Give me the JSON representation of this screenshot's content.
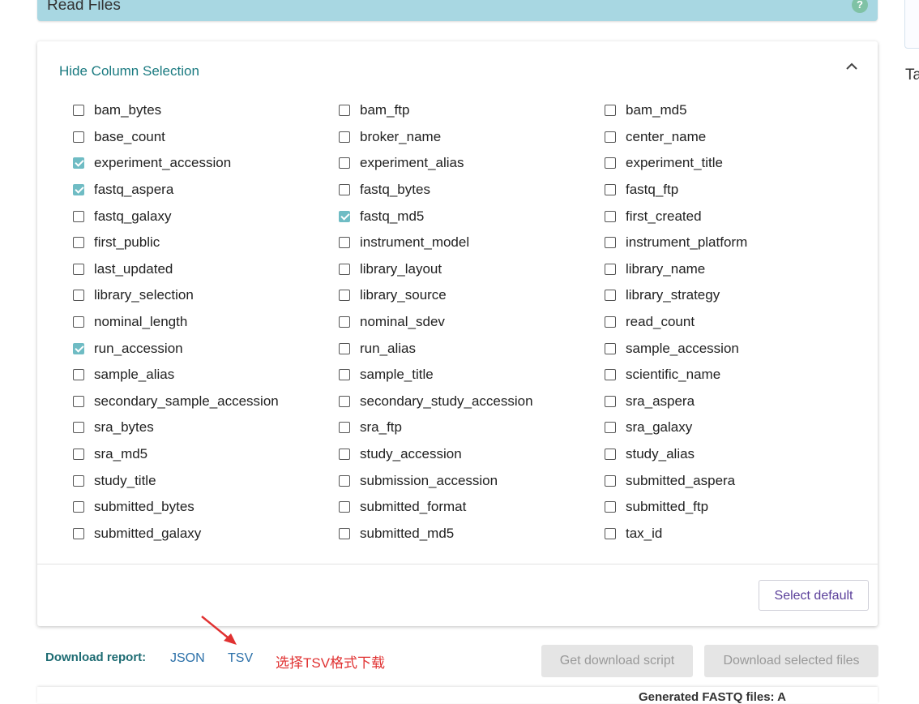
{
  "header": {
    "title": "Read Files",
    "help_symbol": "?"
  },
  "side": {
    "text": "Ta"
  },
  "column_selection": {
    "toggle_label": "Hide Column Selection",
    "columns": [
      {
        "label": "bam_bytes",
        "checked": false
      },
      {
        "label": "bam_ftp",
        "checked": false
      },
      {
        "label": "bam_md5",
        "checked": false
      },
      {
        "label": "base_count",
        "checked": false
      },
      {
        "label": "broker_name",
        "checked": false
      },
      {
        "label": "center_name",
        "checked": false
      },
      {
        "label": "experiment_accession",
        "checked": true
      },
      {
        "label": "experiment_alias",
        "checked": false
      },
      {
        "label": "experiment_title",
        "checked": false
      },
      {
        "label": "fastq_aspera",
        "checked": true
      },
      {
        "label": "fastq_bytes",
        "checked": false
      },
      {
        "label": "fastq_ftp",
        "checked": false
      },
      {
        "label": "fastq_galaxy",
        "checked": false
      },
      {
        "label": "fastq_md5",
        "checked": true
      },
      {
        "label": "first_created",
        "checked": false
      },
      {
        "label": "first_public",
        "checked": false
      },
      {
        "label": "instrument_model",
        "checked": false
      },
      {
        "label": "instrument_platform",
        "checked": false
      },
      {
        "label": "last_updated",
        "checked": false
      },
      {
        "label": "library_layout",
        "checked": false
      },
      {
        "label": "library_name",
        "checked": false
      },
      {
        "label": "library_selection",
        "checked": false
      },
      {
        "label": "library_source",
        "checked": false
      },
      {
        "label": "library_strategy",
        "checked": false
      },
      {
        "label": "nominal_length",
        "checked": false
      },
      {
        "label": "nominal_sdev",
        "checked": false
      },
      {
        "label": "read_count",
        "checked": false
      },
      {
        "label": "run_accession",
        "checked": true
      },
      {
        "label": "run_alias",
        "checked": false
      },
      {
        "label": "sample_accession",
        "checked": false
      },
      {
        "label": "sample_alias",
        "checked": false
      },
      {
        "label": "sample_title",
        "checked": false
      },
      {
        "label": "scientific_name",
        "checked": false
      },
      {
        "label": "secondary_sample_accession",
        "checked": false
      },
      {
        "label": "secondary_study_accession",
        "checked": false
      },
      {
        "label": "sra_aspera",
        "checked": false
      },
      {
        "label": "sra_bytes",
        "checked": false
      },
      {
        "label": "sra_ftp",
        "checked": false
      },
      {
        "label": "sra_galaxy",
        "checked": false
      },
      {
        "label": "sra_md5",
        "checked": false
      },
      {
        "label": "study_accession",
        "checked": false
      },
      {
        "label": "study_alias",
        "checked": false
      },
      {
        "label": "study_title",
        "checked": false
      },
      {
        "label": "submission_accession",
        "checked": false
      },
      {
        "label": "submitted_aspera",
        "checked": false
      },
      {
        "label": "submitted_bytes",
        "checked": false
      },
      {
        "label": "submitted_format",
        "checked": false
      },
      {
        "label": "submitted_ftp",
        "checked": false
      },
      {
        "label": "submitted_galaxy",
        "checked": false
      },
      {
        "label": "submitted_md5",
        "checked": false
      },
      {
        "label": "tax_id",
        "checked": false
      }
    ],
    "select_default_label": "Select default"
  },
  "download": {
    "label": "Download report:",
    "json_label": "JSON",
    "tsv_label": "TSV",
    "annotation": "选择TSV格式下载",
    "script_button": "Get download script",
    "files_button": "Download selected files"
  },
  "bottom": {
    "text": "Generated FASTQ files: A"
  },
  "colors": {
    "header_bg": "#a8d7e2",
    "accent": "#1a7a80",
    "checked": "#6fbcc4",
    "link": "#2a6fa8",
    "annotation": "#e03131"
  },
  "icons": {
    "help": "help-icon",
    "collapse": "chevron-up-icon",
    "annotation_arrow": "arrow-icon"
  }
}
